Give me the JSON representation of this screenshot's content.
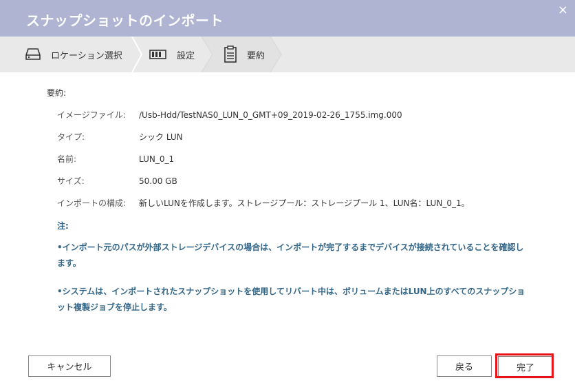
{
  "dialog": {
    "title": "スナップショットのインポート",
    "close_glyph": "×"
  },
  "steps": [
    {
      "label": "ロケーション選択",
      "icon": "drive-icon"
    },
    {
      "label": "設定",
      "icon": "settings-grid-icon"
    },
    {
      "label": "要約",
      "icon": "clipboard-icon",
      "active": true
    }
  ],
  "summary": {
    "heading": "要約:",
    "rows": [
      {
        "key": "イメージファイル:",
        "value": "/Usb-Hdd/TestNAS0_LUN_0_GMT+09_2019-02-26_1755.img.000"
      },
      {
        "key": "タイプ:",
        "value": "シック LUN"
      },
      {
        "key": "名前:",
        "value": "LUN_0_1"
      },
      {
        "key": "サイズ:",
        "value": "50.00 GB"
      },
      {
        "key": "インポートの構成:",
        "value": "新しいLUNを作成します。ストレージプール：ストレージプール 1、LUN名：LUN_0_1。"
      }
    ],
    "note_heading": "注:",
    "notes": [
      "•インポート元のパスが外部ストレージデバイスの場合は、インポートが完了するまでデバイスが接続されていることを確認します。",
      "•システムは、インポートされたスナップショットを使用してリバート中は、ボリュームまたはLUN上のすべてのスナップショット複製ジョブを停止します。"
    ]
  },
  "buttons": {
    "cancel": "キャンセル",
    "back": "戻る",
    "finish": "完了"
  },
  "colors": {
    "titlebar": "#aeb4d1",
    "stepbar": "#e9e9e9",
    "note_text": "#336688",
    "highlight": "#e8141a"
  }
}
